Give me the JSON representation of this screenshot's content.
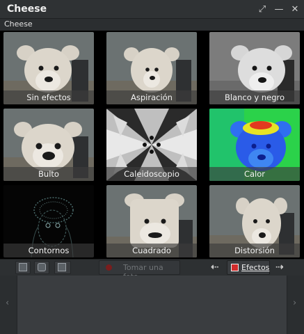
{
  "window": {
    "title": "Cheese",
    "maximize_icon": "maximize-icon",
    "minimize_icon": "minimize-icon",
    "close_icon": "close-icon"
  },
  "menubar": {
    "app_label": "Cheese"
  },
  "effects": [
    {
      "label": "Sin efectos",
      "style": "normal"
    },
    {
      "label": "Aspiración",
      "style": "pinch"
    },
    {
      "label": "Blanco y negro",
      "style": "bw"
    },
    {
      "label": "Bulto",
      "style": "bulge"
    },
    {
      "label": "Caleidoscopio",
      "style": "kaleido"
    },
    {
      "label": "Calor",
      "style": "heat"
    },
    {
      "label": "Contornos",
      "style": "edge"
    },
    {
      "label": "Cuadrado",
      "style": "square"
    },
    {
      "label": "Distorsión",
      "style": "distort"
    }
  ],
  "toolbar": {
    "mode_photo_icon": "photo-mode-icon",
    "mode_burst_icon": "burst-mode-icon",
    "mode_video_icon": "video-mode-icon",
    "shoot_label": "Tomar una foto",
    "prev_icon": "previous-page-icon",
    "effects_label": "Efectos",
    "effects_icon": "effects-icon",
    "next_icon": "next-page-icon"
  },
  "thumbnails": {
    "left_icon": "scroll-left-icon",
    "right_icon": "scroll-right-icon"
  },
  "colors": {
    "background": "#2b2e30",
    "accent_red": "#d22c2c",
    "caption_bg": "rgba(60,60,60,0.65)"
  }
}
